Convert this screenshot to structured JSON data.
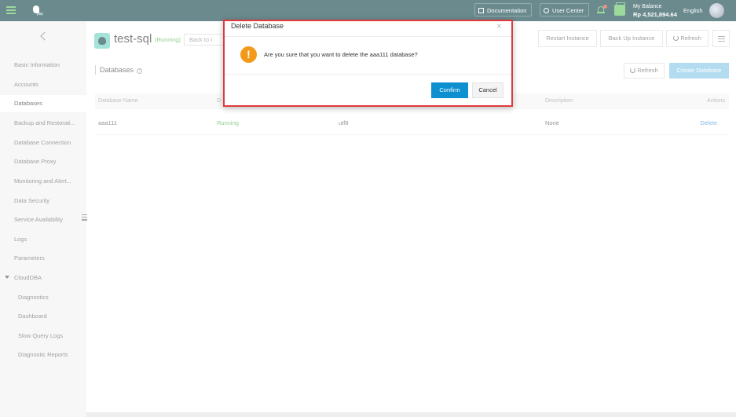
{
  "topbar": {
    "logo_text": "pay",
    "documentation": "Documentation",
    "user_center": "User Center",
    "balance_label": "My Balance",
    "balance_amount": "Rp 4,521,894.64",
    "language": "English"
  },
  "sidebar": {
    "items": [
      "Basic Information",
      "Accounts",
      "Databases",
      "Backup and Restorati...",
      "Database Connection",
      "Database Proxy",
      "Monitoring and Alert...",
      "Data Security",
      "Service Availability",
      "Logs",
      "Parameters",
      "CloudDBA",
      "Diagnostics",
      "Dashboard",
      "Slow Query Logs",
      "Diagnostic Reports"
    ],
    "active": "Databases"
  },
  "header": {
    "instance_name": "test-sql",
    "status": "(Running)",
    "back_link": "Back to I",
    "restart": "Restart Instance",
    "backup": "Back Up Instance",
    "refresh": "Refresh"
  },
  "section": {
    "title": "Databases",
    "refresh": "Refresh",
    "create": "Create Database"
  },
  "table": {
    "columns": {
      "name": "Database Name",
      "status": "D",
      "description": "Description",
      "actions": "Actions"
    },
    "rows": [
      {
        "name": "aaa111",
        "status": "Running",
        "charset": "utf8",
        "description": "None",
        "action": "Delete"
      }
    ]
  },
  "modal": {
    "title": "Delete Database",
    "close": "×",
    "message": "Are you sure that you want to delete the aaa111 database?",
    "confirm": "Confirm",
    "cancel": "Cancel"
  },
  "colors": {
    "topbar": "#0f4349",
    "accent_green": "#5fc25f",
    "primary_blue": "#0e8fd0",
    "warning_orange": "#f39a1a",
    "highlight_red": "#e0393d"
  }
}
